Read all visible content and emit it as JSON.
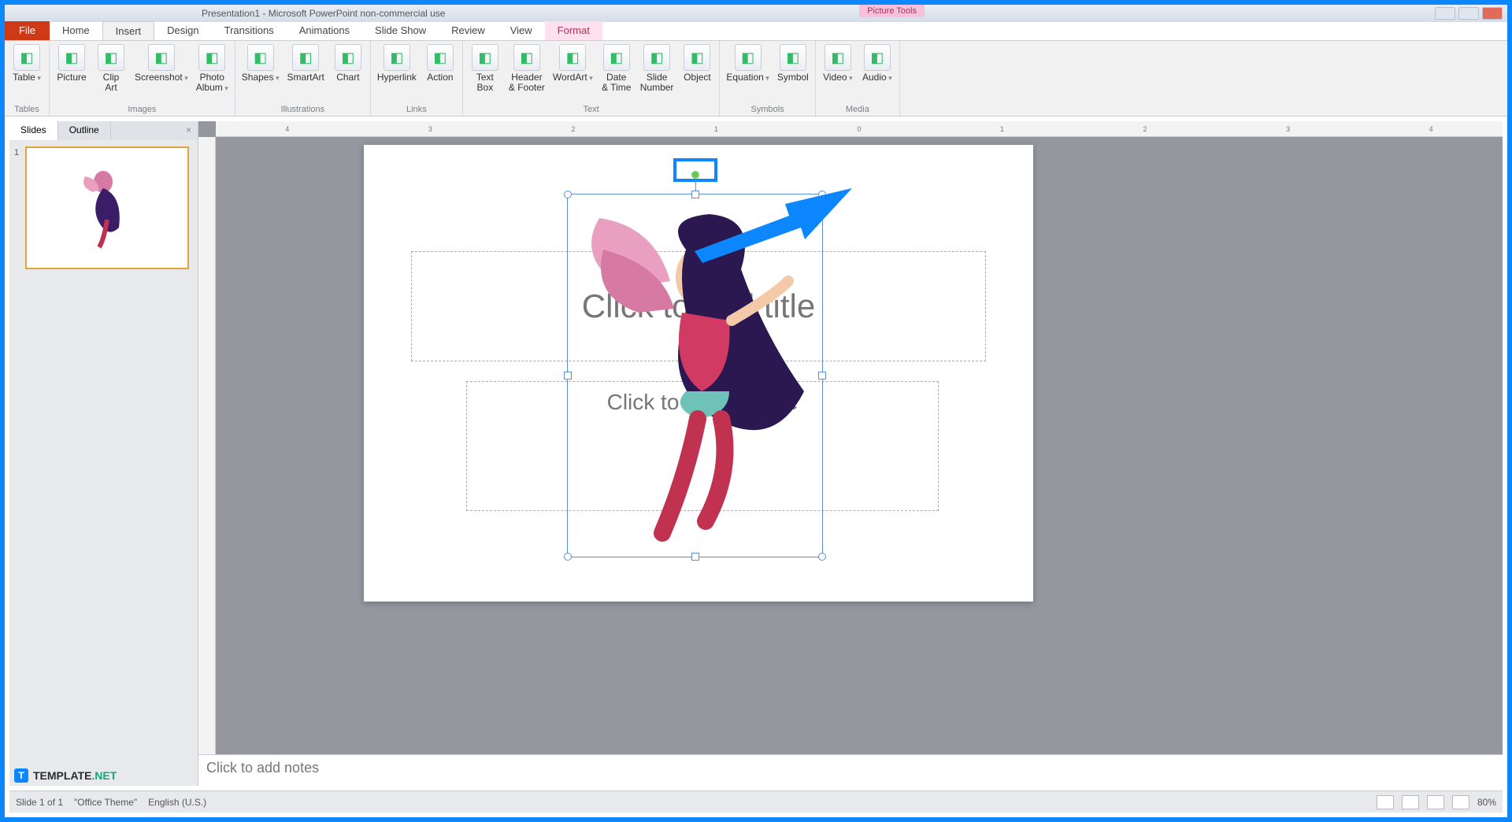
{
  "window": {
    "title": "Presentation1 - Microsoft PowerPoint non-commercial use"
  },
  "context_tab": "Picture Tools",
  "tabs": {
    "file": "File",
    "list": [
      "Home",
      "Insert",
      "Design",
      "Transitions",
      "Animations",
      "Slide Show",
      "Review",
      "View"
    ],
    "active": "Insert",
    "contextual": "Format"
  },
  "ribbon": {
    "groups": [
      {
        "label": "Tables",
        "items": [
          {
            "name": "table",
            "label": "Table",
            "drop": true
          }
        ]
      },
      {
        "label": "Images",
        "items": [
          {
            "name": "picture",
            "label": "Picture"
          },
          {
            "name": "clip-art",
            "label": "Clip\nArt"
          },
          {
            "name": "screenshot",
            "label": "Screenshot",
            "drop": true
          },
          {
            "name": "photo-album",
            "label": "Photo\nAlbum",
            "drop": true
          }
        ]
      },
      {
        "label": "Illustrations",
        "items": [
          {
            "name": "shapes",
            "label": "Shapes",
            "drop": true
          },
          {
            "name": "smartart",
            "label": "SmartArt"
          },
          {
            "name": "chart",
            "label": "Chart"
          }
        ]
      },
      {
        "label": "Links",
        "items": [
          {
            "name": "hyperlink",
            "label": "Hyperlink"
          },
          {
            "name": "action",
            "label": "Action"
          }
        ]
      },
      {
        "label": "Text",
        "items": [
          {
            "name": "text-box",
            "label": "Text\nBox"
          },
          {
            "name": "header-footer",
            "label": "Header\n& Footer"
          },
          {
            "name": "wordart",
            "label": "WordArt",
            "drop": true
          },
          {
            "name": "date-time",
            "label": "Date\n& Time"
          },
          {
            "name": "slide-number",
            "label": "Slide\nNumber"
          },
          {
            "name": "object",
            "label": "Object"
          }
        ]
      },
      {
        "label": "Symbols",
        "items": [
          {
            "name": "equation",
            "label": "Equation",
            "drop": true
          },
          {
            "name": "symbol",
            "label": "Symbol"
          }
        ]
      },
      {
        "label": "Media",
        "items": [
          {
            "name": "video",
            "label": "Video",
            "drop": true
          },
          {
            "name": "audio",
            "label": "Audio",
            "drop": true
          }
        ]
      }
    ]
  },
  "leftpane": {
    "tabs": [
      "Slides",
      "Outline"
    ],
    "active": "Slides",
    "slide_number": "1"
  },
  "hruler_marks": [
    "4",
    "3",
    "2",
    "1",
    "0",
    "1",
    "2",
    "3",
    "4"
  ],
  "placeholders": {
    "title": "Click to add title",
    "subtitle": "Click to add subtitle"
  },
  "notes_placeholder": "Click to add notes",
  "status": {
    "slide": "Slide 1 of 1",
    "theme": "\"Office Theme\"",
    "lang": "English (U.S.)",
    "zoom": "80%"
  },
  "watermark": {
    "brand": "TEMPLATE",
    "suffix": ".NET"
  },
  "annotation": {
    "highlight": "rotation-handle",
    "arrow_color": "#0d87ff"
  }
}
